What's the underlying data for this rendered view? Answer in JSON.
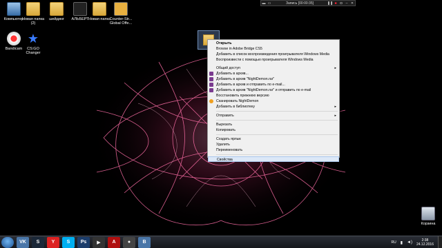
{
  "desktop_icons": [
    {
      "label": "Компьютер",
      "kind": "pc"
    },
    {
      "label": "Новая папка (2)",
      "kind": "folder"
    },
    {
      "label": "шейдинг",
      "kind": "folder"
    },
    {
      "label": "АЛЬБЕРТ",
      "kind": "folder"
    },
    {
      "label": "Новая папка",
      "kind": "folder"
    },
    {
      "label": "Counter-Str... Global Offe...",
      "kind": "app"
    },
    {
      "label": "Bandicam",
      "kind": "app"
    },
    {
      "label": "CS:GO Changer",
      "kind": "app"
    }
  ],
  "recycle_bin": {
    "label": "Корзина"
  },
  "recorder": {
    "title": "Запись [00:00:35]"
  },
  "context_menu": {
    "items": [
      {
        "label": "Открыть",
        "bold": true
      },
      {
        "label": "Browse in Adobe Bridge CS5"
      },
      {
        "label": "Добавить в список воспроизведения проигрывателя Windows Media"
      },
      {
        "label": "Воспроизвести с помощью проигрывателя Windows Media"
      },
      {
        "label": "Общий доступ",
        "submenu": true
      },
      {
        "label": "Добавить в архив..."
      },
      {
        "label": "Добавить в архив \"NightDemon.rar\""
      },
      {
        "label": "Добавить в архив и отправить по e-mail..."
      },
      {
        "label": "Добавить в архив \"NightDemon.rar\" и отправить по e-mail"
      },
      {
        "label": "Восстановить прежнюю версию"
      },
      {
        "label": "Сканировать NightDemon"
      },
      {
        "label": "Добавить в библиотеку",
        "submenu": true
      },
      {
        "label": "Отправить",
        "submenu": true
      },
      {
        "label": "Вырезать"
      },
      {
        "label": "Копировать"
      },
      {
        "label": "Создать ярлык"
      },
      {
        "label": "Удалить"
      },
      {
        "label": "Переименовать"
      },
      {
        "label": "Свойства"
      }
    ]
  },
  "taskbar": {
    "language": "RU",
    "time": "2:38",
    "date": "24.12.2016",
    "pinned": [
      {
        "name": "vk",
        "glyph": "VK",
        "color": "#4a76a8"
      },
      {
        "name": "steam",
        "glyph": "S",
        "color": "#1b2838"
      },
      {
        "name": "yandex",
        "glyph": "Y",
        "color": "#d22"
      },
      {
        "name": "skype",
        "glyph": "S",
        "color": "#00aff0"
      },
      {
        "name": "photoshop",
        "glyph": "Ps",
        "color": "#1c3d6b"
      },
      {
        "name": "media",
        "glyph": "▶",
        "color": "#333"
      },
      {
        "name": "adobe",
        "glyph": "A",
        "color": "#b01010"
      },
      {
        "name": "bandicam",
        "glyph": "●",
        "color": "#444"
      },
      {
        "name": "vk-app",
        "glyph": "B",
        "color": "#4a76a8"
      }
    ]
  }
}
